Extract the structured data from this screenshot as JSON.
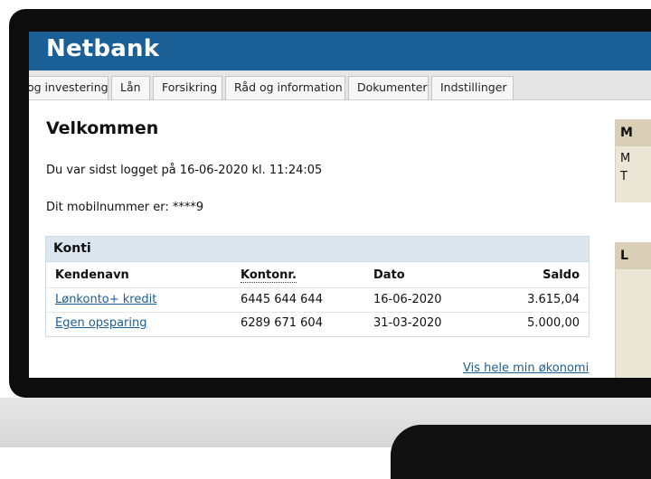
{
  "header": {
    "logo": "Netbank"
  },
  "nav": {
    "tabs": [
      "og investering",
      "Lån",
      "Forsikring",
      "Råd og information",
      "Dokumenter",
      "Indstillinger"
    ]
  },
  "main": {
    "title": "Velkommen",
    "last_login": "Du var sidst logget på 16-06-2020 kl. 11:24:05",
    "mobile": "Dit mobilnummer er: ****9",
    "konti": {
      "title": "Konti",
      "columns": [
        "Kendenavn",
        "Kontonr.",
        "Dato",
        "Saldo"
      ],
      "rows": [
        {
          "name": "Lønkonto+ kredit",
          "number": "6445 644 644",
          "date": "16-06-2020",
          "balance": "3.615,04"
        },
        {
          "name": "Egen opsparing",
          "number": "6289 671 604",
          "date": "31-03-2020",
          "balance": "5.000,00"
        }
      ]
    },
    "vis_link": "Vis hele min økonomi"
  },
  "sidebar": {
    "box1_head": "M",
    "box1_lines": [
      "M",
      "T"
    ],
    "box2_head": "L"
  }
}
